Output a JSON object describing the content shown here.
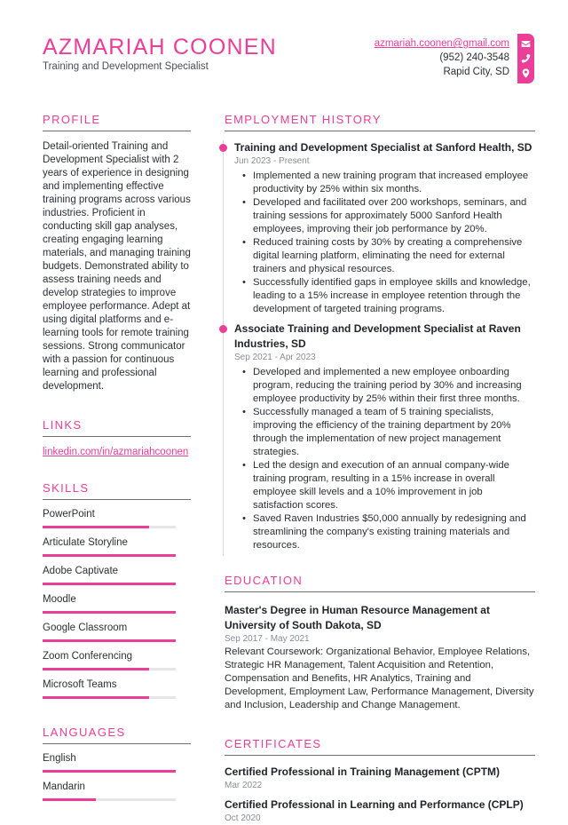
{
  "header": {
    "name": "AZMARIAH COONEN",
    "title": "Training and Development Specialist"
  },
  "contact": {
    "email": "azmariah.coonen@gmail.com",
    "phone": "(952) 240-3548",
    "location": "Rapid City, SD",
    "icons": [
      "envelope-icon",
      "phone-icon",
      "map-pin-icon"
    ]
  },
  "colors": {
    "accent": "#ea3e98",
    "text": "#2c2f36",
    "muted": "#8a8d94",
    "rule": "#6e717a"
  },
  "profile": {
    "heading": "PROFILE",
    "text": "Detail-oriented Training and Development Specialist with 2 years of experience in designing and implementing effective training programs across various industries. Proficient in conducting skill gap analyses, creating engaging learning materials, and managing training budgets. Demonstrated ability to assess training needs and develop strategies to improve employee performance. Adept at using digital platforms and e-learning tools for remote training sessions. Strong communicator with a passion for continuous learning and professional development."
  },
  "links": {
    "heading": "LINKS",
    "items": [
      {
        "label": "linkedin.com/in/azmariahcoonen"
      }
    ]
  },
  "skills": {
    "heading": "SKILLS",
    "items": [
      {
        "name": "PowerPoint",
        "level": 0.8
      },
      {
        "name": "Articulate Storyline",
        "level": 1.0
      },
      {
        "name": "Adobe Captivate",
        "level": 1.0
      },
      {
        "name": "Moodle",
        "level": 1.0
      },
      {
        "name": "Google Classroom",
        "level": 1.0
      },
      {
        "name": "Zoom Conferencing",
        "level": 0.8
      },
      {
        "name": "Microsoft Teams",
        "level": 0.8
      }
    ]
  },
  "languages": {
    "heading": "LANGUAGES",
    "items": [
      {
        "name": "English",
        "level": 1.0
      },
      {
        "name": "Mandarin",
        "level": 0.4
      }
    ]
  },
  "employment": {
    "heading": "EMPLOYMENT HISTORY",
    "jobs": [
      {
        "title": "Training and Development Specialist at Sanford Health, SD",
        "date": "Jun 2023 - Present",
        "bullets": [
          "Implemented a new training program that increased employee productivity by 25% within six months.",
          "Developed and facilitated over 200 workshops, seminars, and training sessions for approximately 5000 Sanford Health employees, improving their job performance by 20%.",
          "Reduced training costs by 30% by creating a comprehensive digital learning platform, eliminating the need for external trainers and physical resources.",
          "Successfully identified gaps in employee skills and knowledge, leading to a 15% increase in employee retention through the development of targeted training programs."
        ]
      },
      {
        "title": "Associate Training and Development Specialist at Raven Industries, SD",
        "date": "Sep 2021 - Apr 2023",
        "bullets": [
          "Developed and implemented a new employee onboarding program, reducing the training period by 30% and increasing employee productivity by 25% within their first three months.",
          "Successfully managed a team of 5 training specialists, improving the efficiency of the training department by 20% through the implementation of new project management strategies.",
          "Led the design and execution of an annual company-wide training program, resulting in a 15% increase in overall employee skill levels and a 10% improvement in job satisfaction scores.",
          "Saved Raven Industries $50,000 annually by redesigning and streamlining the company's existing training materials and resources."
        ]
      }
    ]
  },
  "education": {
    "heading": "EDUCATION",
    "items": [
      {
        "title": "Master's Degree in Human Resource Management at University of South Dakota, SD",
        "date": "Sep 2017 - May 2021",
        "text": "Relevant Coursework: Organizational Behavior, Employee Relations, Strategic HR Management, Talent Acquisition and Retention, Compensation and Benefits, HR Analytics, Training and Development, Employment Law, Performance Management, Diversity and Inclusion, Leadership and Change Management."
      }
    ]
  },
  "certificates": {
    "heading": "CERTIFICATES",
    "items": [
      {
        "title": "Certified Professional in Training Management (CPTM)",
        "date": "Mar 2022"
      },
      {
        "title": "Certified Professional in Learning and Performance (CPLP)",
        "date": "Oct 2020"
      }
    ]
  }
}
